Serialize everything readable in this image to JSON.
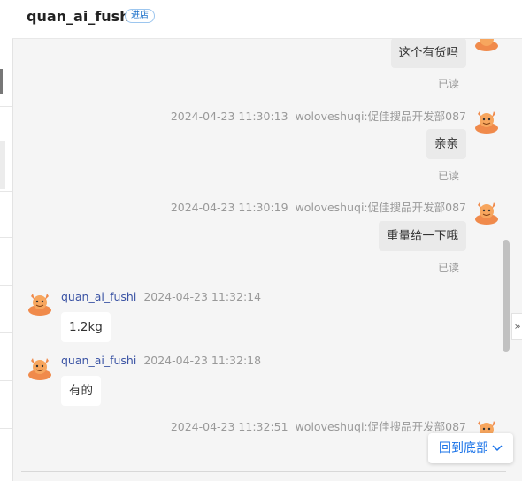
{
  "header": {
    "shop_name": "quan_ai_fushi",
    "enter_label": "进店"
  },
  "messages": [
    {
      "side": "right",
      "text": "这个有货吗",
      "status": "已读"
    },
    {
      "side": "right",
      "time": "2024-04-23 11:30:13",
      "sender": "woloveshuqi:促佳搜品开发部087",
      "text": "亲亲",
      "status": "已读"
    },
    {
      "side": "right",
      "time": "2024-04-23 11:30:19",
      "sender": "woloveshuqi:促佳搜品开发部087",
      "text": "重量给一下哦",
      "status": "已读"
    },
    {
      "side": "left",
      "time": "2024-04-23 11:32:14",
      "sender": "quan_ai_fushi",
      "text": "1.2kg"
    },
    {
      "side": "left",
      "time": "2024-04-23 11:32:18",
      "sender": "quan_ai_fushi",
      "text": "有的"
    },
    {
      "side": "right",
      "time": "2024-04-23 11:32:51",
      "sender": "woloveshuqi:促佳搜品开发部087"
    }
  ],
  "back_to_bottom": {
    "label": "回到底部"
  },
  "side_toggle": {
    "glyph": "»"
  },
  "colors": {
    "accent": "#1a73e8",
    "avatar_orange": "#f08a4b",
    "sender_link": "#3a53a4"
  }
}
